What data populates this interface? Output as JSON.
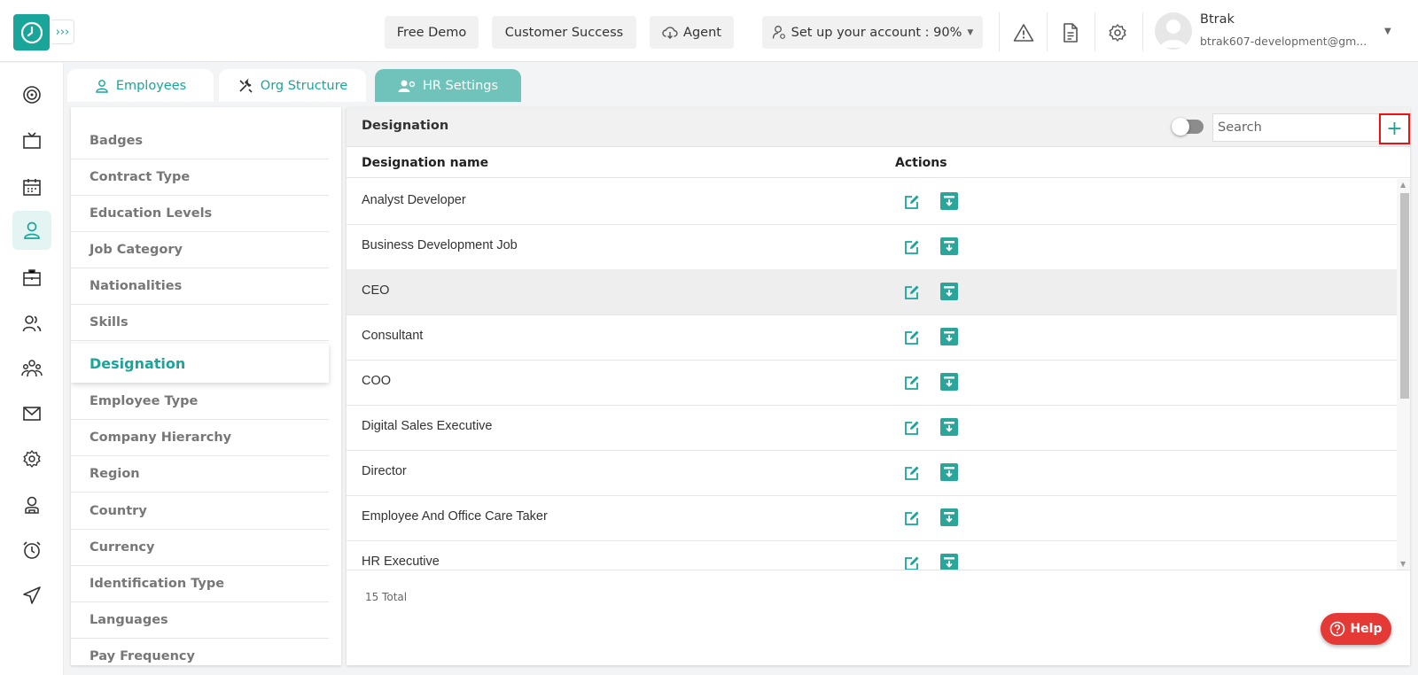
{
  "topbar": {
    "free_demo": "Free Demo",
    "customer_success": "Customer Success",
    "agent": "Agent",
    "setup": "Set up your account : 90%",
    "user_name": "Btrak",
    "user_email": "btrak607-development@gm..."
  },
  "tabs": [
    {
      "label": "Employees"
    },
    {
      "label": "Org Structure"
    },
    {
      "label": "HR Settings"
    }
  ],
  "menu": {
    "items": [
      "Badges",
      "Contract Type",
      "Education Levels",
      "Job Category",
      "Nationalities",
      "Skills",
      "Designation",
      "Employee Type",
      "Company Hierarchy",
      "Region",
      "Country",
      "Currency",
      "Identification Type",
      "Languages",
      "Pay Frequency"
    ],
    "active": "Designation"
  },
  "panel": {
    "title": "Designation",
    "search_placeholder": "Search",
    "add_label": "+",
    "columns": {
      "name": "Designation name",
      "actions": "Actions"
    },
    "rows": [
      "Analyst Developer",
      "Business Development Job",
      "CEO",
      "Consultant",
      "COO",
      "Digital Sales Executive",
      "Director",
      "Employee And Office Care Taker",
      "HR Executive"
    ],
    "highlighted_row": "CEO",
    "total": "15 Total"
  },
  "help": {
    "label": "Help"
  },
  "colors": {
    "accent": "#1aa59a",
    "tab_active": "#6fc3ba",
    "help": "#e53935",
    "highlight_border": "#ee1111"
  }
}
